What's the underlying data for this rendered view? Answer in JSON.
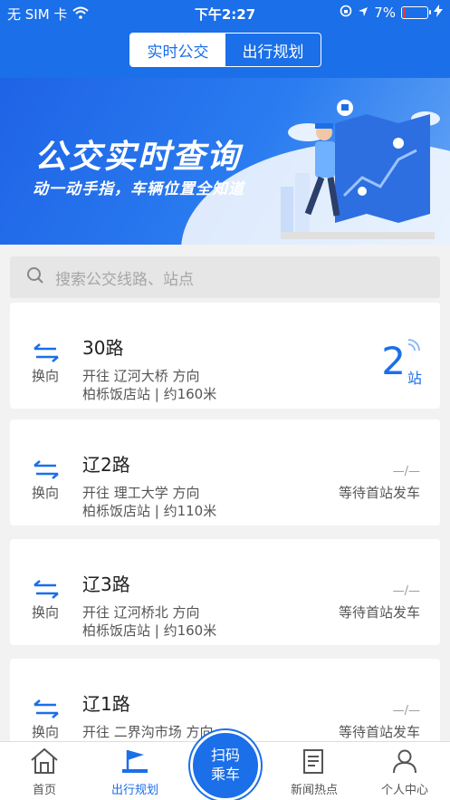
{
  "status_bar": {
    "carrier": "无 SIM 卡",
    "time": "下午2:27",
    "battery": "7%",
    "battery_level": 0.07
  },
  "header": {
    "tabs": [
      {
        "label": "实时公交",
        "active": true
      },
      {
        "label": "出行规划",
        "active": false
      }
    ]
  },
  "banner": {
    "title": "公交实时查询",
    "subtitle": "动一动手指，车辆位置全知道"
  },
  "search": {
    "placeholder": "搜索公交线路、站点"
  },
  "routes": [
    {
      "swap": "换向",
      "name": "30路",
      "direction": "开往 辽河大桥 方向",
      "stop": "柏栎饭店站 | 约160米",
      "stops_away": "2",
      "stops_unit": "站"
    },
    {
      "swap": "换向",
      "name": "辽2路",
      "direction": "开往 理工大学 方向",
      "stop": "柏栎饭店站 | 约110米",
      "dash": "—/—",
      "status": "等待首站发车"
    },
    {
      "swap": "换向",
      "name": "辽3路",
      "direction": "开往 辽河桥北 方向",
      "stop": "柏栎饭店站 | 约160米",
      "dash": "—/—",
      "status": "等待首站发车"
    },
    {
      "swap": "换向",
      "name": "辽1路",
      "direction": "开往 二界沟市场 方向",
      "dash": "—/—",
      "status": "等待首站发车"
    }
  ],
  "tabbar": {
    "items": [
      {
        "label": "首页",
        "icon": "home-icon"
      },
      {
        "label": "出行规划",
        "icon": "flag-icon",
        "active": true
      },
      {
        "label": "新闻热点",
        "icon": "news-icon"
      },
      {
        "label": "个人中心",
        "icon": "person-icon"
      }
    ],
    "scan_line1": "扫码",
    "scan_line2": "乘车"
  },
  "colors": {
    "accent": "#1b6fe8",
    "background": "#f2f2f2"
  }
}
